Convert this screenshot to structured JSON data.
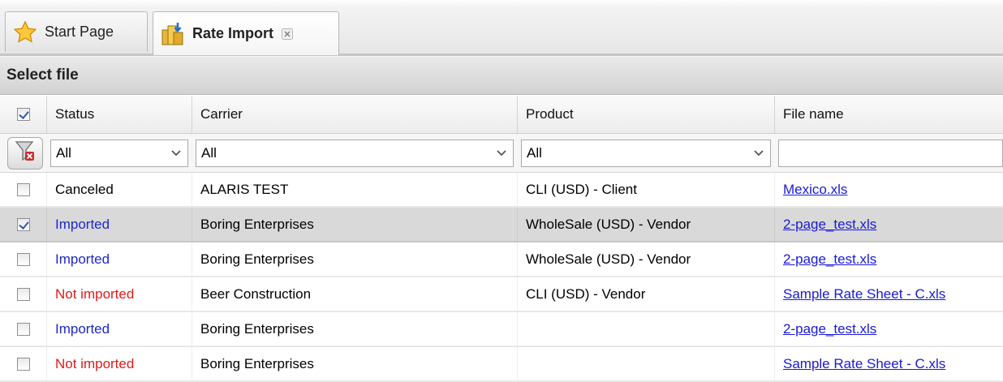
{
  "tabs": [
    {
      "label": "Start Page",
      "icon": "star-icon"
    },
    {
      "label": "Rate Import",
      "icon": "import-icon",
      "active": true
    }
  ],
  "section": {
    "title": "Select file"
  },
  "grid": {
    "columns": [
      "Status",
      "Carrier",
      "Product",
      "File name"
    ],
    "filters": {
      "status": "All",
      "carrier": "All",
      "product": "All",
      "file_name": ""
    },
    "rows": [
      {
        "checked": false,
        "status": "Canceled",
        "carrier": "ALARIS TEST",
        "product": "CLI (USD) - Client",
        "file": "Mexico.xls"
      },
      {
        "checked": true,
        "status": "Imported",
        "carrier": "Boring Enterprises",
        "product": "WholeSale (USD) - Vendor",
        "file": "2-page_test.xls"
      },
      {
        "checked": false,
        "status": "Imported",
        "carrier": "Boring Enterprises",
        "product": "WholeSale (USD) - Vendor",
        "file": "2-page_test.xls"
      },
      {
        "checked": false,
        "status": "Not imported",
        "carrier": "Beer Construction",
        "product": "CLI (USD) - Vendor",
        "file": "Sample Rate Sheet - C.xls"
      },
      {
        "checked": false,
        "status": "Imported",
        "carrier": "Boring Enterprises",
        "product": "",
        "file": "2-page_test.xls"
      },
      {
        "checked": false,
        "status": "Not imported",
        "carrier": "Boring Enterprises",
        "product": "",
        "file": "Sample Rate Sheet - C.xls"
      }
    ]
  },
  "colors": {
    "imported": "#1c28cc",
    "not_imported": "#e01a1a",
    "link": "#1a1ad6",
    "selected_row": "#d9d9d9"
  }
}
